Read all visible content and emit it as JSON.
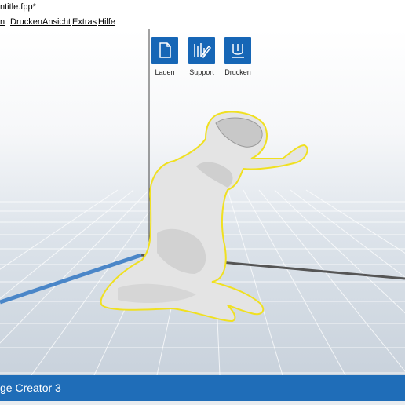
{
  "window": {
    "title": "ntitle.fpp*"
  },
  "menu": {
    "items": [
      {
        "label": "n"
      },
      {
        "label": "Drucken"
      },
      {
        "label": "Ansicht"
      },
      {
        "label": "Extras"
      },
      {
        "label": "Hilfe"
      }
    ]
  },
  "toolbar": {
    "load_label": "Laden",
    "support_label": "Support",
    "print_label": "Drucken"
  },
  "statusbar": {
    "text": "ge Creator 3"
  },
  "colors": {
    "accent": "#1f6db8",
    "button": "#1666b6",
    "model_outline": "#f0e020",
    "axis_x": "#4a86c8",
    "axis_y": "#555555"
  },
  "icons": [
    "document-icon",
    "support-icon",
    "print-icon",
    "minimize-icon"
  ]
}
